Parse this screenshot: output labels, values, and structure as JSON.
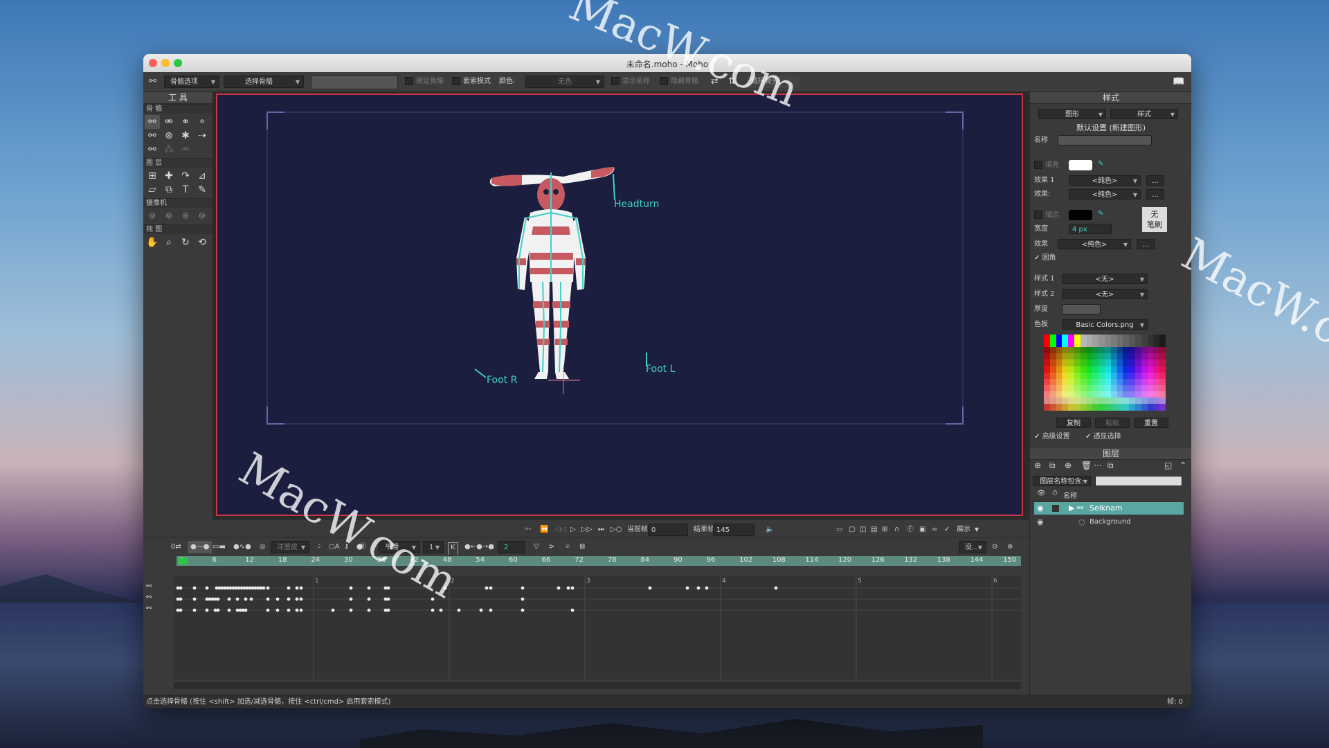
{
  "window": {
    "title": "未命名.moho - Moho"
  },
  "watermark": "MacW.com",
  "toolbar": {
    "bone_options": "骨骼选项",
    "select_bone": "选择骨骼",
    "lock_bone": "锁定骨骼",
    "lasso_mode": "套索模式",
    "color_label": "颜色:",
    "color_value": "无色",
    "show_names": "显示名称",
    "hide_bones": "隐藏骨骼",
    "link_bones": "链接骨头"
  },
  "tools_panel": {
    "title": "工 具",
    "sections": {
      "bone": "骨 骼",
      "layer": "图 层",
      "camera": "摄像机",
      "view": "视 图"
    }
  },
  "canvas": {
    "labels": {
      "headturn": "Headturn",
      "foot_r": "Foot R",
      "foot_l": "Foot L"
    }
  },
  "transport": {
    "current_frame_label": "当前帧",
    "current_frame": "0",
    "end_frame_label": "结束帧",
    "end_frame": "145",
    "display_label": "展示"
  },
  "timeline_toolbar": {
    "onion": "洋葱皮",
    "interp": "平滑",
    "interp_num": "1",
    "key_label": "K",
    "step": "2",
    "none_label": "没..."
  },
  "timeline": {
    "ruler_ticks": [
      "0",
      "6",
      "12",
      "18",
      "24",
      "30",
      "36",
      "42",
      "48",
      "54",
      "60",
      "66",
      "72",
      "78",
      "84",
      "90",
      "96",
      "102",
      "108",
      "114",
      "120",
      "126",
      "132",
      "138",
      "144",
      "150"
    ],
    "second_marks": [
      "1",
      "2",
      "3",
      "4",
      "5",
      "6"
    ]
  },
  "status": {
    "hint": "点击选择骨骼 (按住 <shift> 加选/减选骨骼，按住 <ctrl/cmd> 启用套索模式)",
    "frame": "帧: 0"
  },
  "style_panel": {
    "title": "样式",
    "shape_dd": "图形",
    "style_dd": "样式",
    "defaults": "默认设置 (新建图形)",
    "name_label": "名称",
    "fill_label": "填充",
    "effect1_label": "效果 1",
    "effect2_label": "效果:",
    "solid": "<纯色>",
    "stroke_label": "描边",
    "width_label": "宽度",
    "width_value": "4 px",
    "effect_label": "效果",
    "no_brush": "无\n笔刷",
    "round_caps": "圆角",
    "style1_label": "样式 1",
    "style2_label": "样式 2",
    "none": "<无>",
    "thickness_label": "厚度",
    "palette_label": "色板",
    "palette_value": "Basic Colors.png",
    "copy": "复制",
    "paste": "粘贴",
    "reset": "重置",
    "advanced": "高级设置",
    "transparency_select": "透显选择",
    "colors": {
      "fill": "#ffffff",
      "stroke": "#000000"
    }
  },
  "layers_panel": {
    "title": "图层",
    "filter_label": "图层名称包含:",
    "name_col": "名称",
    "layers": [
      {
        "name": "Selknam",
        "selected": true
      },
      {
        "name": "Background",
        "selected": false
      }
    ]
  },
  "colors": {
    "stage_bg": "#1c1e3f",
    "stage_border": "#cc3344",
    "bone": "#3fd1c8",
    "ruler": "#5d8a7f",
    "selected_layer": "#5aa7a1"
  }
}
